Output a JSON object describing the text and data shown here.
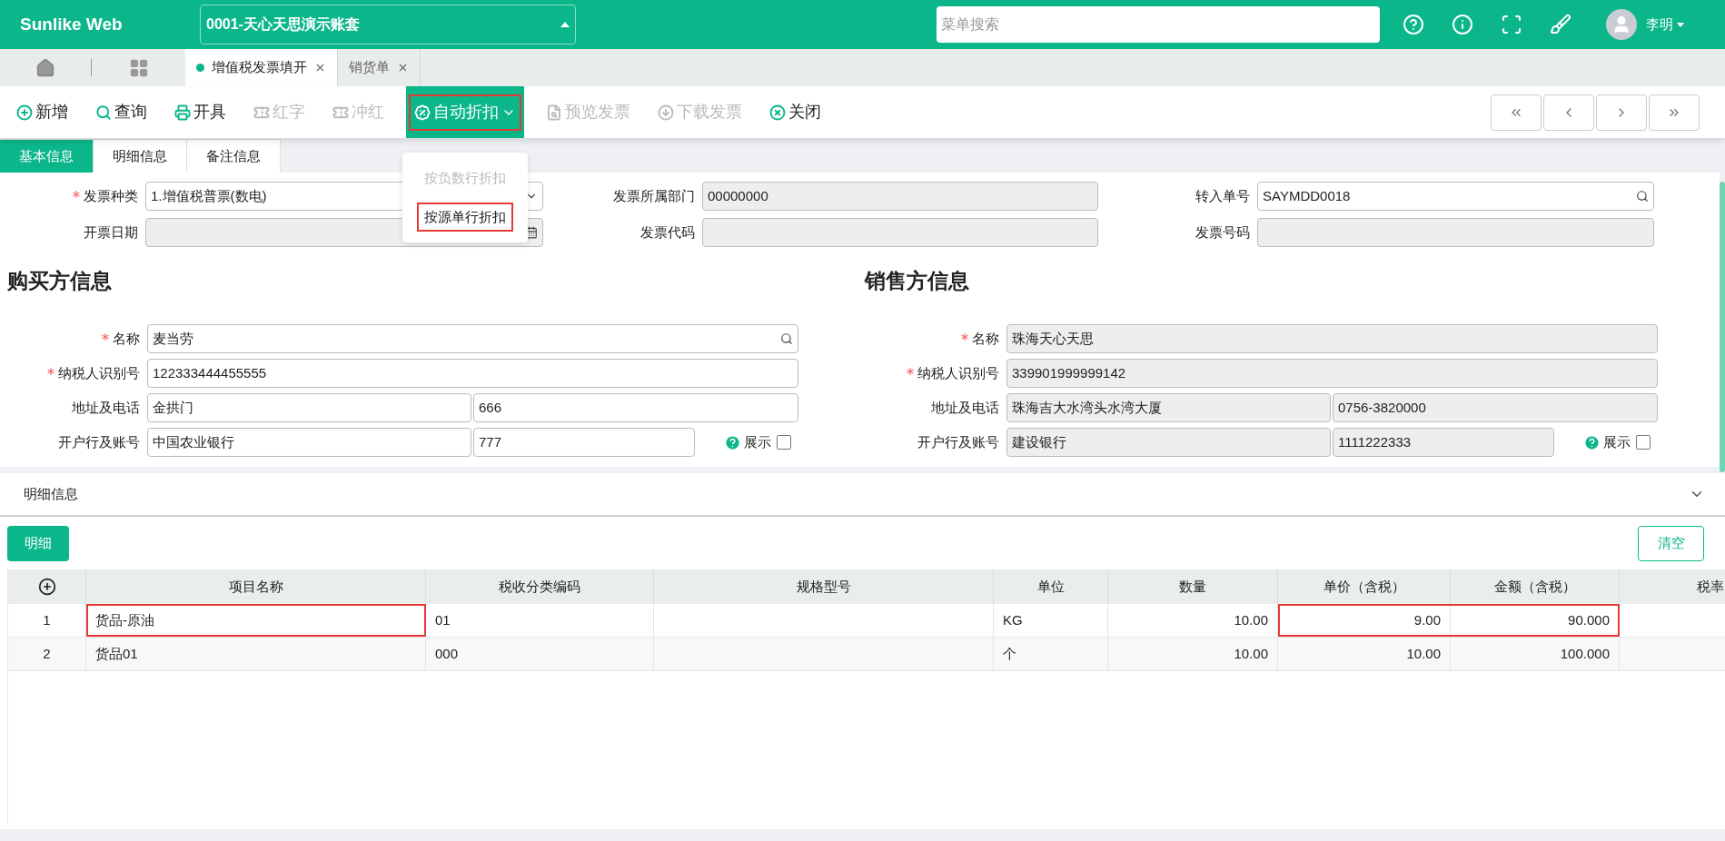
{
  "header": {
    "logo": "Sunlike Web",
    "account": "0001-天心天思演示账套",
    "search": {
      "placeholder": "菜单搜索"
    },
    "user": "李明"
  },
  "page_tabs": [
    {
      "label": "增值税发票填开",
      "selected": true
    },
    {
      "label": "销货单",
      "selected": false
    }
  ],
  "toolbar": [
    {
      "label": "新增",
      "disabled": false,
      "highlighted": false
    },
    {
      "label": "查询",
      "disabled": false,
      "highlighted": false
    },
    {
      "label": "开具",
      "disabled": false,
      "highlighted": false
    },
    {
      "label": "红字",
      "disabled": true,
      "highlighted": false
    },
    {
      "label": "冲红",
      "disabled": true,
      "highlighted": false
    },
    {
      "label": "自动折扣",
      "disabled": false,
      "highlighted": true,
      "kind": "dropdown",
      "expanded": true
    },
    {
      "label": "预览发票",
      "disabled": true,
      "highlighted": false
    },
    {
      "label": "下载发票",
      "disabled": true,
      "highlighted": false
    },
    {
      "label": "关闭",
      "disabled": false,
      "highlighted": false
    }
  ],
  "dropdown_menu": [
    {
      "label": "按负数行折扣",
      "disabled": true,
      "highlighted": false
    },
    {
      "label": "按源单行折扣",
      "disabled": false,
      "highlighted": true
    }
  ],
  "form_tabs": [
    {
      "label": "基本信息",
      "selected": true
    },
    {
      "label": "明细信息",
      "selected": false
    },
    {
      "label": "备注信息",
      "selected": false
    }
  ],
  "invoice_fields": [
    {
      "label": "发票种类",
      "required": true,
      "value": "1.增值税普票(数电)",
      "kind": "select",
      "disabled": false
    },
    {
      "label": "发票所属部门",
      "required": false,
      "value": "00000000",
      "kind": "text",
      "disabled": true
    },
    {
      "label": "转入单号",
      "required": false,
      "value": "SAYMDD0018",
      "kind": "lookup",
      "disabled": false
    },
    {
      "label": "开票日期",
      "required": false,
      "kind": "date",
      "disabled": true
    },
    {
      "label": "发票代码",
      "required": false,
      "kind": "text",
      "disabled": true
    },
    {
      "label": "发票号码",
      "required": false,
      "kind": "text",
      "disabled": true
    }
  ],
  "parties": [
    {
      "title": "购买方信息",
      "disabled": false,
      "show_toggle": {
        "label": "展示",
        "checked": false
      },
      "rows": [
        {
          "label": "名称",
          "required": true,
          "kind": "lookup",
          "values": [
            "麦当劳"
          ]
        },
        {
          "label": "纳税人识别号",
          "required": true,
          "kind": "text",
          "values": [
            "122333444455555"
          ]
        },
        {
          "label": "地址及电话",
          "required": false,
          "kind": "pair",
          "values": [
            "金拱门",
            "666"
          ]
        },
        {
          "label": "开户行及账号",
          "required": false,
          "kind": "bank",
          "values": [
            "中国农业银行",
            "777"
          ]
        }
      ]
    },
    {
      "title": "销售方信息",
      "disabled": true,
      "show_toggle": {
        "label": "展示",
        "checked": false
      },
      "rows": [
        {
          "label": "名称",
          "required": true,
          "kind": "text",
          "values": [
            "珠海天心天思"
          ]
        },
        {
          "label": "纳税人识别号",
          "required": true,
          "kind": "text",
          "values": [
            "339901999999142"
          ]
        },
        {
          "label": "地址及电话",
          "required": false,
          "kind": "pair",
          "values": [
            "珠海吉大水湾头水湾大厦",
            "0756-3820000"
          ]
        },
        {
          "label": "开户行及账号",
          "required": false,
          "kind": "bank",
          "values": [
            "建设银行",
            "1111222333"
          ]
        }
      ]
    }
  ],
  "detail": {
    "title": "明细信息",
    "expanded": true,
    "add_button": "明细",
    "clear_button": "清空",
    "columns": [
      "",
      "项目名称",
      "税收分类编码",
      "规格型号",
      "单位",
      "数量",
      "单价（含税）",
      "金额（含税）",
      "税率"
    ],
    "rows": [
      {
        "cells": [
          {
            "text": "1",
            "highlighted": false
          },
          {
            "text": "货品-原油",
            "highlighted": true
          },
          {
            "text": "01",
            "highlighted": false
          },
          {
            "highlighted": false
          },
          {
            "text": "KG",
            "highlighted": false
          },
          {
            "text": "10.00",
            "highlighted": false
          },
          {
            "text": "9.00",
            "highlighted": true
          },
          {
            "text": "90.000",
            "highlighted": true
          },
          {
            "highlighted": false
          }
        ]
      },
      {
        "cells": [
          {
            "text": "2",
            "highlighted": false
          },
          {
            "text": "货品01",
            "highlighted": false
          },
          {
            "text": "000",
            "highlighted": false
          },
          {
            "highlighted": false
          },
          {
            "text": "个",
            "highlighted": false
          },
          {
            "text": "10.00",
            "highlighted": false
          },
          {
            "text": "10.00",
            "highlighted": false
          },
          {
            "text": "100.000",
            "highlighted": false
          },
          {
            "highlighted": false
          }
        ]
      }
    ]
  }
}
